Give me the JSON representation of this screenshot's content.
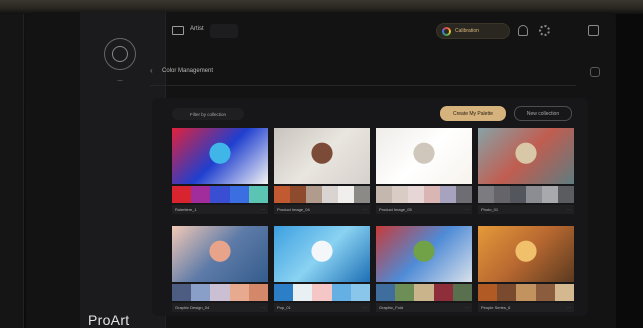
{
  "sidebar": {
    "user_label": "—",
    "brand": "ProArt"
  },
  "topbar": {
    "device_name": "Artist",
    "calibration_label": "Calibration"
  },
  "section": {
    "title": "Color Management"
  },
  "toolbar": {
    "filter_label": "Filter by collection",
    "primary_label": "Create My Palette",
    "secondary_label": "New collection"
  },
  "cards": [
    {
      "label": "Ruleritem_1",
      "more": "···",
      "thumb": [
        "#e2213a",
        "#1f3fcf",
        "#3fb5e8",
        "#f4f4f4"
      ],
      "swatches": [
        "#d8242e",
        "#a12c9c",
        "#3a4ed3",
        "#3b6ee0",
        "#5cc4b2"
      ]
    },
    {
      "label": "Product Image_04",
      "more": "···",
      "thumb": [
        "#c8c3bd",
        "#e9e5df",
        "#7b4b38",
        "#d6d1cc"
      ],
      "swatches": [
        "#c15a30",
        "#8d4a2c",
        "#b09b8c",
        "#d9d4cf",
        "#f0efed",
        "#8c8a87"
      ]
    },
    {
      "label": "Product Image_05",
      "more": "···",
      "thumb": [
        "#efece8",
        "#ffffff",
        "#d0c7bc",
        "#f7f3ee"
      ],
      "swatches": [
        "#c4b8ae",
        "#d8ccc5",
        "#e6d7d6",
        "#d9b6b4",
        "#a7a2be",
        "#6e6d74"
      ]
    },
    {
      "label": "Photo_01",
      "more": "···",
      "thumb": [
        "#86a3a7",
        "#c15d50",
        "#d9c8a8",
        "#5e7c80"
      ],
      "swatches": [
        "#7c7c80",
        "#646469",
        "#53565c",
        "#8b8d92",
        "#a7a9ad",
        "#5a5c60"
      ]
    },
    {
      "label": "Graphic Design_04",
      "more": "···",
      "thumb": [
        "#f2c9b6",
        "#5e7ba8",
        "#e8a48a",
        "#345c8c"
      ],
      "swatches": [
        "#4d5d82",
        "#8a9fc7",
        "#cbbfd4",
        "#e7aa8e",
        "#d38969"
      ]
    },
    {
      "label": "Pop_01",
      "more": "···",
      "thumb": [
        "#3c9fe0",
        "#8ad2f2",
        "#f4f7f9",
        "#1d6fb5"
      ],
      "swatches": [
        "#2c7fc7",
        "#e9f0f4",
        "#f5c6c6",
        "#64b0e4",
        "#89c6ea"
      ]
    },
    {
      "label": "Graphic_Fold",
      "more": "···",
      "thumb": [
        "#c73b3a",
        "#4f8bd6",
        "#71a248",
        "#d9e1ea"
      ],
      "swatches": [
        "#3f6e9e",
        "#6e8e57",
        "#c9b48b",
        "#8e2e3a",
        "#58704d"
      ]
    },
    {
      "label": "People Series_6",
      "more": "···",
      "thumb": [
        "#e49a3a",
        "#b86830",
        "#f0c06a",
        "#5a3a20"
      ],
      "swatches": [
        "#b15a24",
        "#7a4a2e",
        "#c2935e",
        "#8b5d3e",
        "#d4b890"
      ]
    }
  ]
}
